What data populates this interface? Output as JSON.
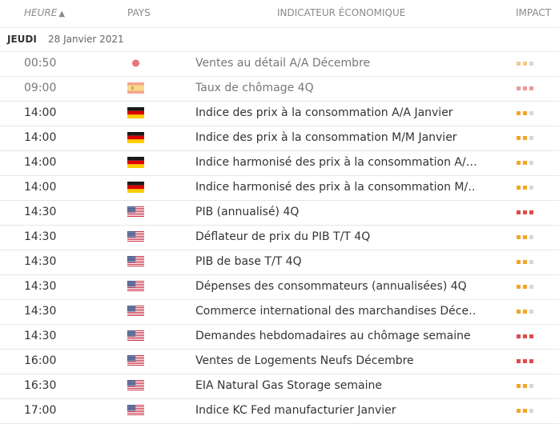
{
  "header": {
    "time": "HEURE",
    "time_sort_icon": "▲",
    "country": "PAYS",
    "indicator": "INDICATEUR ÉCONOMIQUE",
    "impact": "IMPACT"
  },
  "date_group": {
    "day": "JEUDI",
    "date": "28 Janvier 2021"
  },
  "impact_colors": {
    "medium": "#f5a623",
    "high": "#e04b4b",
    "inactive": "#d6d6d6"
  },
  "events": [
    {
      "time": "00:50",
      "country": "japan-flag",
      "indicator": "Ventes au détail A/A Décembre",
      "impact": 2,
      "past": true
    },
    {
      "time": "09:00",
      "country": "spain-flag",
      "indicator": "Taux de chômage 4Q",
      "impact": 3,
      "past": true
    },
    {
      "time": "14:00",
      "country": "germany-flag",
      "indicator": "Indice des prix à la consommation A/A Janvier",
      "impact": 2,
      "past": false
    },
    {
      "time": "14:00",
      "country": "germany-flag",
      "indicator": "Indice des prix à la consommation M/M Janvier",
      "impact": 2,
      "past": false
    },
    {
      "time": "14:00",
      "country": "germany-flag",
      "indicator": "Indice harmonisé des prix à la consommation A/…",
      "impact": 2,
      "past": false
    },
    {
      "time": "14:00",
      "country": "germany-flag",
      "indicator": "Indice harmonisé des prix à la consommation M/…",
      "impact": 2,
      "past": false
    },
    {
      "time": "14:30",
      "country": "usa-flag",
      "indicator": "PIB (annualisé) 4Q",
      "impact": 3,
      "past": false
    },
    {
      "time": "14:30",
      "country": "usa-flag",
      "indicator": "Déflateur de prix du PIB T/T 4Q",
      "impact": 2,
      "past": false
    },
    {
      "time": "14:30",
      "country": "usa-flag",
      "indicator": "PIB de base T/T 4Q",
      "impact": 2,
      "past": false
    },
    {
      "time": "14:30",
      "country": "usa-flag",
      "indicator": "Dépenses des consommateurs (annualisées) 4Q",
      "impact": 2,
      "past": false
    },
    {
      "time": "14:30",
      "country": "usa-flag",
      "indicator": "Commerce international des marchandises Déce…",
      "impact": 2,
      "past": false
    },
    {
      "time": "14:30",
      "country": "usa-flag",
      "indicator": "Demandes hebdomadaires au chômage semaine",
      "impact": 3,
      "past": false
    },
    {
      "time": "16:00",
      "country": "usa-flag",
      "indicator": "Ventes de Logements Neufs Décembre",
      "impact": 3,
      "past": false
    },
    {
      "time": "16:30",
      "country": "usa-flag",
      "indicator": "EIA Natural Gas Storage semaine",
      "impact": 2,
      "past": false
    },
    {
      "time": "17:00",
      "country": "usa-flag",
      "indicator": "Indice KC Fed manufacturier Janvier",
      "impact": 2,
      "past": false
    }
  ]
}
